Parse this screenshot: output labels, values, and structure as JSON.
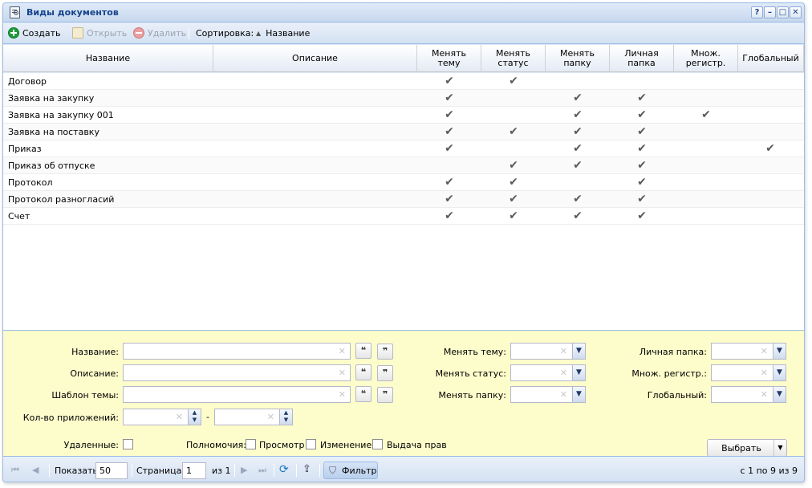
{
  "window": {
    "title": "Виды документов",
    "controls": [
      "?",
      "–",
      "□",
      "✕"
    ]
  },
  "toolbar": {
    "create": "Создать",
    "open": "Открыть",
    "delete": "Удалить",
    "sort_label": "Сортировка:",
    "sort_arrow": "▲",
    "sort_field": "Название"
  },
  "grid": {
    "columns": [
      {
        "label": "Название"
      },
      {
        "label": "Описание"
      },
      {
        "label": "Менять тему"
      },
      {
        "label": "Менять статус"
      },
      {
        "label": "Менять папку"
      },
      {
        "label": "Личная папка"
      },
      {
        "label": "Множ. регистр."
      },
      {
        "label": "Глобальный"
      }
    ],
    "check_mark": "✔",
    "rows": [
      {
        "name": "Договор",
        "description": "",
        "flags": [
          true,
          true,
          false,
          false,
          false,
          false
        ]
      },
      {
        "name": "Заявка на закупку",
        "description": "",
        "flags": [
          true,
          false,
          true,
          true,
          false,
          false
        ]
      },
      {
        "name": "Заявка на закупку 001",
        "description": "",
        "flags": [
          true,
          false,
          true,
          true,
          true,
          false
        ]
      },
      {
        "name": "Заявка на поставку",
        "description": "",
        "flags": [
          true,
          true,
          true,
          true,
          false,
          false
        ]
      },
      {
        "name": "Приказ",
        "description": "",
        "flags": [
          true,
          false,
          true,
          true,
          false,
          true
        ]
      },
      {
        "name": "Приказ об отпуске",
        "description": "",
        "flags": [
          false,
          true,
          true,
          true,
          false,
          false
        ]
      },
      {
        "name": "Протокол",
        "description": "",
        "flags": [
          true,
          true,
          false,
          true,
          false,
          false
        ]
      },
      {
        "name": "Протокол разногласий",
        "description": "",
        "flags": [
          true,
          true,
          true,
          true,
          false,
          false
        ]
      },
      {
        "name": "Счет",
        "description": "",
        "flags": [
          true,
          true,
          true,
          true,
          false,
          false
        ]
      }
    ]
  },
  "filter": {
    "name_label": "Название:",
    "description_label": "Описание:",
    "template_label": "Шаблон темы:",
    "attachments_label": "Кол-во приложений:",
    "range_dash": "-",
    "change_theme_label": "Менять тему:",
    "change_status_label": "Менять статус:",
    "change_folder_label": "Менять папку:",
    "personal_folder_label": "Личная папка:",
    "multi_register_label": "Множ. регистр.:",
    "global_label": "Глобальный:",
    "deleted_label": "Удаленные:",
    "permissions_label": "Полномочия:",
    "view_label": "Просмотр",
    "edit_label": "Изменение",
    "grant_label": "Выдача прав",
    "select_button": "Выбрать",
    "quote_open": "❝",
    "quote_close": "❞",
    "clear_glyph": "✕",
    "arrow_glyph": "▼"
  },
  "pager": {
    "show_label": "Показать",
    "page_size": "50",
    "page_label": "Страница",
    "page": "1",
    "of_label": "из 1",
    "filter_button": "Фильтр",
    "summary": "с 1 по 9 из 9"
  }
}
